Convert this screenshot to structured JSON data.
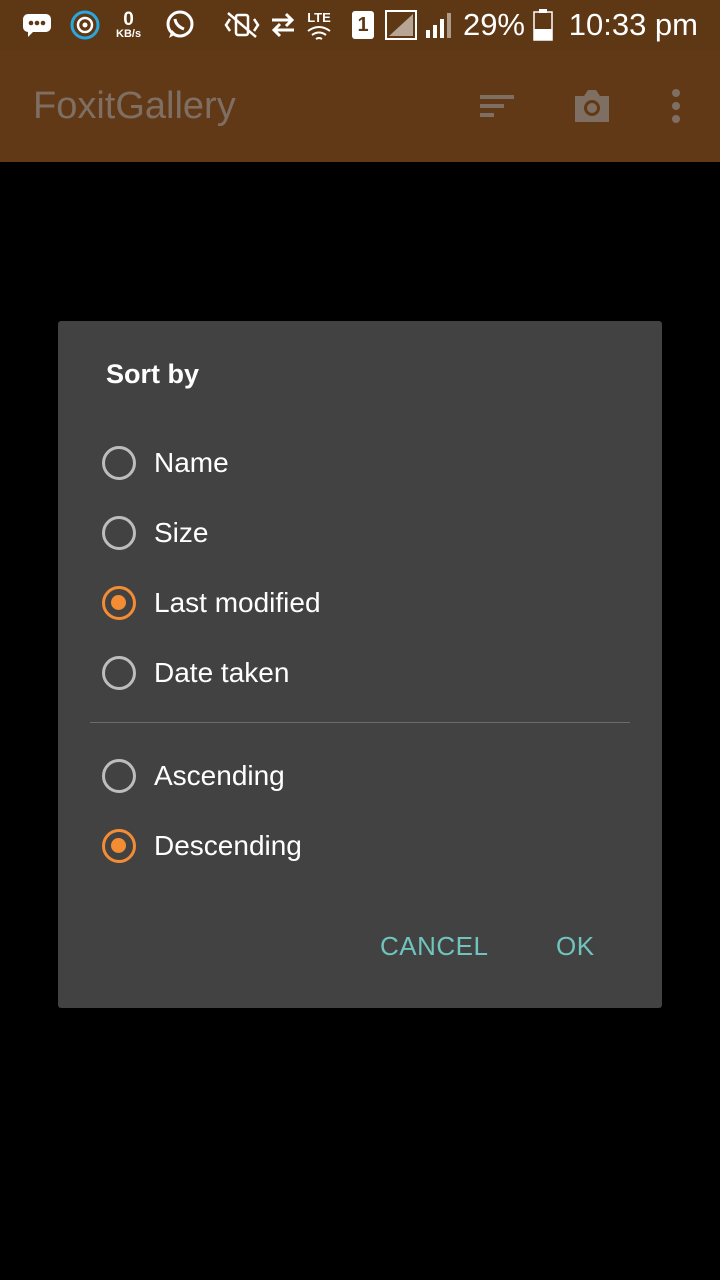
{
  "status_bar": {
    "speed_value": "0",
    "speed_unit": "KB/s",
    "network": "LTE",
    "sim_slot": "1",
    "battery_percent": "29%",
    "time": "10:33 pm"
  },
  "app_bar": {
    "title": "FoxitGallery",
    "icons": [
      "sort-icon",
      "camera-icon",
      "more-vert-icon"
    ]
  },
  "dialog": {
    "title": "Sort by",
    "sort_options": [
      {
        "label": "Name",
        "selected": false
      },
      {
        "label": "Size",
        "selected": false
      },
      {
        "label": "Last modified",
        "selected": true
      },
      {
        "label": "Date taken",
        "selected": false
      }
    ],
    "order_options": [
      {
        "label": "Ascending",
        "selected": false
      },
      {
        "label": "Descending",
        "selected": true
      }
    ],
    "cancel_label": "CANCEL",
    "ok_label": "OK"
  },
  "colors": {
    "accent": "#f48c34",
    "button_text": "#6fc4bd",
    "app_bar": "#623916",
    "dialog_bg": "#424242"
  }
}
